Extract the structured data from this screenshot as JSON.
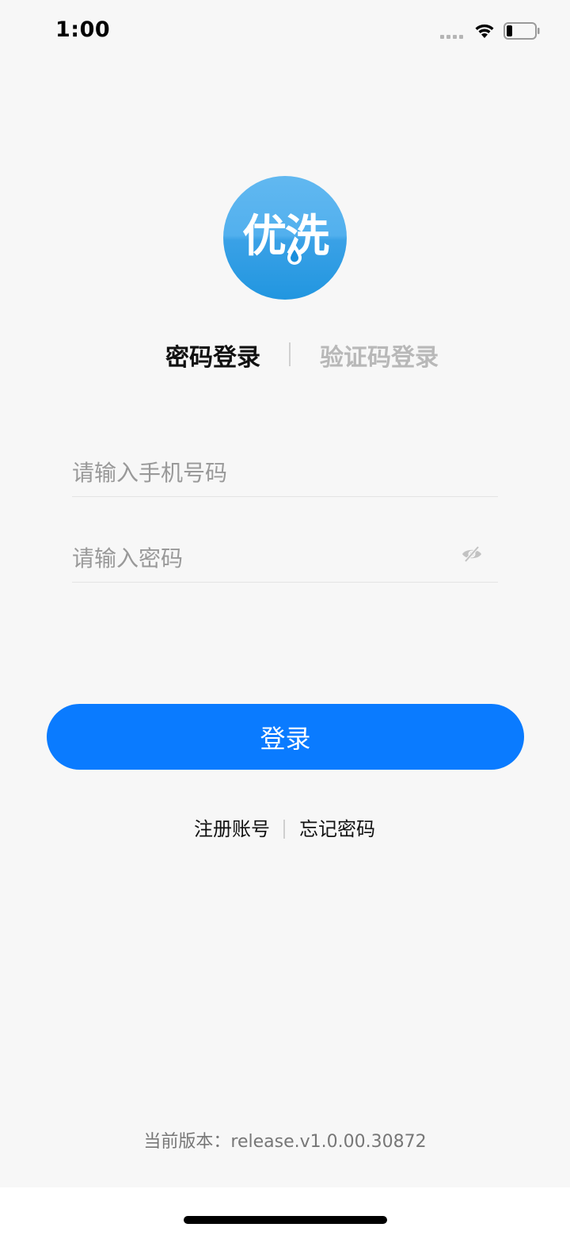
{
  "status_bar": {
    "time": "1:00",
    "icons": [
      "signal-icon",
      "wifi-icon",
      "battery-icon"
    ]
  },
  "logo": {
    "text": "优洗",
    "colors": {
      "primary": "#52b0ee",
      "secondary": "#2196e0"
    }
  },
  "tabs": [
    {
      "label": "密码登录",
      "active": true
    },
    {
      "label": "验证码登录",
      "active": false
    }
  ],
  "form": {
    "phone_placeholder": "请输入手机号码",
    "phone_value": "",
    "password_placeholder": "请输入密码",
    "password_value": "",
    "password_toggle_icon": "eye-off-icon"
  },
  "login_button": {
    "label": "登录",
    "color": "#0a7bff"
  },
  "links": {
    "register": "注册账号",
    "forgot_password": "忘记密码"
  },
  "version_text": "当前版本：release.v1.0.00.30872"
}
